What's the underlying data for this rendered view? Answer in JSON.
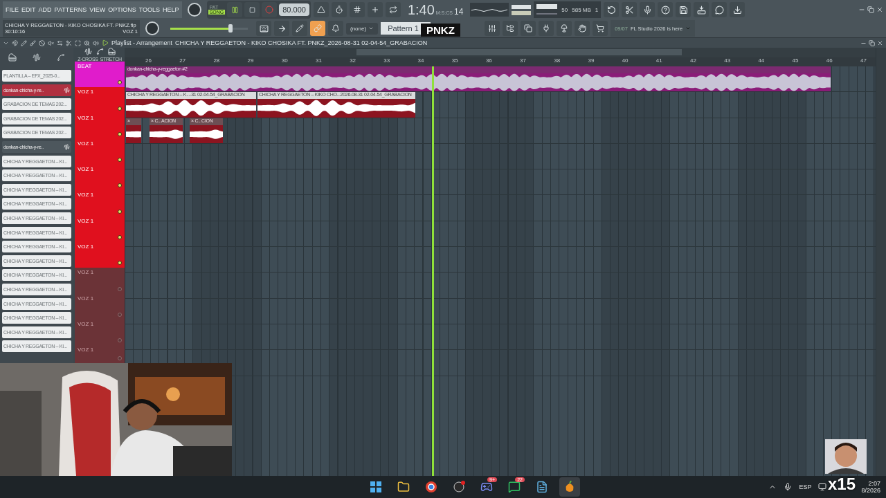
{
  "menu": [
    "FILE",
    "EDIT",
    "ADD",
    "PATTERNS",
    "VIEW",
    "OPTIONS",
    "TOOLS",
    "HELP"
  ],
  "transport": {
    "modes": [
      {
        "label": "PAT",
        "selected": false
      },
      {
        "label": "SONG",
        "selected": true
      }
    ],
    "tempo": "80.000",
    "time": "1:40",
    "time_cs": "14",
    "time_unit": "M:S:CS"
  },
  "cpu": {
    "value": "50",
    "memory": "585 MB",
    "polyphony": "1"
  },
  "project": {
    "file": "CHICHA Y REGGAETON - KIKO CHOSIKA FT. PNKZ.flp",
    "time": "30:10:16",
    "channel": "VOZ 1"
  },
  "master_volume": {
    "level": 0.75
  },
  "snap": "(none)",
  "pattern": "Pattern 1",
  "link_on": true,
  "news": {
    "date": "09/07",
    "text": "FL Studio 2026 is here"
  },
  "playlist": {
    "title": "Playlist - Arrangement",
    "arrangement": "CHICHA Y REGGAETON - KIKO CHOSIKA FT. PNKZ_2026-08-31 02-04-54_GRABACION",
    "options": [
      "Z-CROSS",
      "STRETCH"
    ]
  },
  "browser": [
    {
      "label": "PLANTILLA – EFX_2025-0...",
      "kind": "plain",
      "selected": false
    },
    {
      "label": "donkan-chicha-y-re..",
      "kind": "source",
      "selected": true
    },
    {
      "label": "GRABACION DE TEMAS 202...",
      "kind": "plain",
      "selected": false
    },
    {
      "label": "GRABACION DE TEMAS 202...",
      "kind": "plain",
      "selected": false
    },
    {
      "label": "GRABACION DE TEMAS 202...",
      "kind": "plain",
      "selected": false
    },
    {
      "label": "donkan-chicha-y-re..",
      "kind": "source",
      "selected": false
    },
    {
      "label": "CHICHA Y REGGAETON – KI...",
      "kind": "plain",
      "selected": false
    },
    {
      "label": "CHICHA Y REGGAETON – KI...",
      "kind": "plain",
      "selected": false
    },
    {
      "label": "CHICHA Y REGGAETON – KI...",
      "kind": "plain",
      "selected": false
    },
    {
      "label": "CHICHA Y REGGAETON – KI...",
      "kind": "plain",
      "selected": false
    },
    {
      "label": "CHICHA Y REGGAETON – KI...",
      "kind": "plain",
      "selected": false
    },
    {
      "label": "CHICHA Y REGGAETON – KI...",
      "kind": "plain",
      "selected": false
    },
    {
      "label": "CHICHA Y REGGAETON – KI...",
      "kind": "plain",
      "selected": false
    },
    {
      "label": "CHICHA Y REGGAETON – KI...",
      "kind": "plain",
      "selected": false
    },
    {
      "label": "CHICHA Y REGGAETON – KI...",
      "kind": "plain",
      "selected": false
    },
    {
      "label": "CHICHA Y REGGAETON – KI...",
      "kind": "plain",
      "selected": false
    },
    {
      "label": "CHICHA Y REGGAETON – KI...",
      "kind": "plain",
      "selected": false
    },
    {
      "label": "CHICHA Y REGGAETON – KI...",
      "kind": "plain",
      "selected": false
    },
    {
      "label": "CHICHA Y REGGAETON – KI...",
      "kind": "plain",
      "selected": false
    },
    {
      "label": "CHICHA Y REGGAETON – KI...",
      "kind": "plain",
      "selected": false
    }
  ],
  "ruler": [
    "26",
    "27",
    "28",
    "29",
    "30",
    "31",
    "32",
    "33",
    "34",
    "35",
    "36",
    "37",
    "38",
    "39",
    "40",
    "41",
    "42",
    "43",
    "44",
    "45",
    "46",
    "47"
  ],
  "tracks": [
    {
      "name": "BEAT",
      "color": "#e01ccb",
      "enabled": true,
      "clips": [
        {
          "title": "donkan-chicha-y-reggaeton #2",
          "kind": "beat"
        }
      ]
    },
    {
      "name": "VOZ 1",
      "color": "#e0101e",
      "enabled": true,
      "clips": [
        {
          "title": "CHICHA Y REGGAETON – K...-31 02-04-54_GRABACION",
          "kind": "vocal"
        },
        {
          "title": "CHICHA Y REGGAETON – KIKO CHO...2026-08-31 02-04-54_GRABACION",
          "kind": "vocal"
        }
      ]
    },
    {
      "name": "VOZ 1",
      "color": "#e0101e",
      "enabled": true,
      "clips": [
        {
          "title": "×",
          "kind": "short"
        },
        {
          "title": "× C...ACION",
          "kind": "short"
        },
        {
          "title": "× C...CION",
          "kind": "short"
        }
      ]
    },
    {
      "name": "VOZ 1",
      "color": "#e0101e",
      "enabled": true
    },
    {
      "name": "VOZ 1",
      "color": "#e0101e",
      "enabled": true
    },
    {
      "name": "VOZ 1",
      "color": "#e0101e",
      "enabled": true
    },
    {
      "name": "VOZ 1",
      "color": "#e0101e",
      "enabled": true
    },
    {
      "name": "VOZ 1",
      "color": "#e0101e",
      "enabled": true
    },
    {
      "name": "VOZ 1",
      "color": "#6b3337",
      "enabled": false
    },
    {
      "name": "VOZ 1",
      "color": "#6b3337",
      "enabled": false
    },
    {
      "name": "VOZ 1",
      "color": "#6b3337",
      "enabled": false
    },
    {
      "name": "VOZ 1",
      "color": "#6b3337",
      "enabled": false
    }
  ],
  "taskbar": {
    "badges": [
      "9+",
      "22"
    ],
    "language": "ESP",
    "clock": "2:07",
    "date": "8/2026"
  },
  "overlays": {
    "logo": "PNKZ",
    "counter": "x15"
  }
}
